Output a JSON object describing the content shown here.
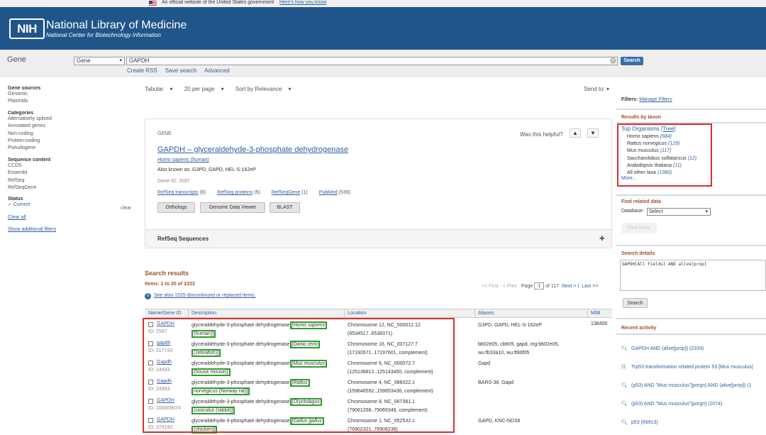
{
  "gov_banner": {
    "text": "An official website of the United States government",
    "link": "Here's how you know"
  },
  "header": {
    "logo": "NIH",
    "title": "National Library of Medicine",
    "subtitle": "National Center for Biotechnology Information"
  },
  "search": {
    "db_title": "Gene",
    "db_selected": "Gene",
    "query": "GAPDH",
    "button": "Search",
    "links": [
      "Create RSS",
      "Save search",
      "Advanced"
    ]
  },
  "sidebar": {
    "groups": [
      {
        "title": "Gene sources",
        "items": [
          "Genomic",
          "Plasmids"
        ]
      },
      {
        "title": "Categories",
        "items": [
          "Alternatively spliced",
          "Annotated genes",
          "Non-coding",
          "Protein-coding",
          "Pseudogene"
        ]
      },
      {
        "title": "Sequence content",
        "items": [
          "CCDS",
          "Ensembl",
          "RefSeq",
          "RefSeqGene"
        ]
      },
      {
        "title": "Status",
        "items": [
          "Current"
        ]
      }
    ],
    "clear_label": "clear",
    "current_check": "✓",
    "clear_all": "Clear all",
    "show_additional": "Show additional filters"
  },
  "toolbar": {
    "format": "Tabular",
    "per_page": "20 per page",
    "sort": "Sort by Relevance",
    "send_to": "Send to:"
  },
  "gene_card": {
    "label": "GENE",
    "helpful": "Was this helpful?",
    "title": "GAPDH – glyceraldehyde-3-phosphate dehydrogenase",
    "organism": "Homo sapiens (human)",
    "also_known": "Also known as: G3PD, GAPD, HEL-S-162eP",
    "gene_id": "Gene ID: 2597",
    "links": [
      {
        "label": "RefSeq transcripts",
        "count": "(6)"
      },
      {
        "label": "RefSeq proteins",
        "count": "(5)"
      },
      {
        "label": "RefSeqGene",
        "count": "(1)"
      },
      {
        "label": "PubMed",
        "count": "(539)"
      }
    ],
    "buttons": [
      "Orthologs",
      "Genome Data Viewer",
      "BLAST"
    ],
    "refseq_section": "RefSeq Sequences",
    "expand_icon": "+"
  },
  "results": {
    "title": "Search results",
    "items": "Items: 1 to 20 of 2333",
    "see_also": "See also 1525 discontinued or replaced items.",
    "pager": {
      "first": "<< First",
      "prev": "< Prev",
      "page_label": "Page",
      "page": "1",
      "of": "of 117",
      "next": "Next >",
      "last": "Last >>"
    },
    "columns": [
      "Name/Gene ID",
      "Description",
      "Location",
      "Aliases",
      "MIM"
    ],
    "rows": [
      {
        "symbol": "GAPDH",
        "id": "ID: 2597",
        "desc": "glyceraldehyde-3-phosphate dehydrogenase",
        "org1": "[Homo sapiens",
        "org2": "(human)]",
        "loc1": "Chromosome 12, NC_000012.12",
        "loc2": "(6534517..6538371)",
        "alias1": "G3PD, GAPD, HEL-S-162eP",
        "alias2": "",
        "mim": "138400"
      },
      {
        "symbol": "gapdh",
        "id": "ID: 317743",
        "desc": "glyceraldehyde-3-phosphate dehydrogenase",
        "org1": "[Danio rerio",
        "org2": "(zebrafish)]",
        "loc1": "Chromosome 16, NC_007127.7",
        "loc2": "(17192671..17197601, complement)",
        "alias1": "bb02e05, cb609, gapd, mg:bb02e05,",
        "alias2": "wu:fb33a10, wu:ft80f05",
        "mim": ""
      },
      {
        "symbol": "Gapdh",
        "id": "ID: 14433",
        "desc": "glyceraldehyde-3-phosphate dehydrogenase",
        "org1": "[Mus musculus",
        "org2": "(house mouse)]",
        "loc1": "Chromosome 6, NC_000072.7",
        "loc2": "(125138812..125143450, complement)",
        "alias1": "Gapd",
        "alias2": "",
        "mim": ""
      },
      {
        "symbol": "Gapdh",
        "id": "ID: 24383",
        "desc": "glyceraldehyde-3-phosphate dehydrogenase",
        "org1": "[Rattus",
        "org2": "norvegicus (Norway rat)]",
        "loc1": "Chromosome 4, NC_086022.1",
        "loc2": "(159648592..159653436, complement)",
        "alias1": "BARS-38, Gapd",
        "alias2": "",
        "mim": ""
      },
      {
        "symbol": "GAPDH",
        "id": "ID: 100009074",
        "desc": "glyceraldehyde-3-phosphate dehydrogenase",
        "org1": "[Oryctolagus",
        "org2": "cuniculus (rabbit)]",
        "loc1": "Chromosome 8, NC_067381.1",
        "loc2": "(79061268..79065349, complement)",
        "alias1": "",
        "alias2": "",
        "mim": ""
      },
      {
        "symbol": "GAPDH",
        "id": "ID: 374193",
        "desc": "glyceraldehyde-3-phosphate dehydrogenase",
        "org1": "[Gallus gallus",
        "org2": "(chicken)]",
        "loc1": "Chromosome 1, NC_052532.1",
        "loc2": "(76902321..76906238)",
        "alias1": "GAPD, KNC-NDS6",
        "alias2": "",
        "mim": ""
      }
    ]
  },
  "right_panel": {
    "filters_label": "Filters:",
    "manage_filters": "Manage Filters",
    "taxon_title": "Results by taxon",
    "top_organisms": "Top Organisms",
    "tree": "[Tree]",
    "organisms": [
      {
        "name": "Homo sapiens",
        "count": "(684)"
      },
      {
        "name": "Rattus norvegicus",
        "count": "(129)"
      },
      {
        "name": "Mus musculus",
        "count": "(117)"
      },
      {
        "name": "Saccharolobus solfataricus",
        "count": "(12)"
      },
      {
        "name": "Arabidopsis thaliana",
        "count": "(11)"
      },
      {
        "name": "All other taxa",
        "count": "(1380)"
      }
    ],
    "more": "More...",
    "find_related_title": "Find related data",
    "database_label": "Database:",
    "database_selected": "Select",
    "find_items_btn": "Find items",
    "details_title": "Search details",
    "details_query": "GAPDH[All Fields] AND alive[prop]",
    "search_btn": "Search",
    "recent_title": "Recent activity",
    "recent": [
      {
        "icon": "search-icon",
        "text": "GAPDH AND (alive[prop]) (2333)"
      },
      {
        "icon": "document-icon",
        "text": "Trp53 transformation related protein 53 [Mus musculus]"
      },
      {
        "icon": "search-icon",
        "text": "(p53) AND \"Mus musculus\"[porgn] AND (alive[prop]) (1"
      },
      {
        "icon": "search-icon",
        "text": "(p53) AND \"Mus musculus\"[porgn] (2074)"
      },
      {
        "icon": "search-icon",
        "text": "p53 (69913)"
      }
    ]
  },
  "colors": {
    "header_bg": "#20558a",
    "link": "#2f5e9e",
    "section_title": "#a0522d",
    "highlight_red": "#d93030",
    "highlight_green": "#2aa02a"
  }
}
